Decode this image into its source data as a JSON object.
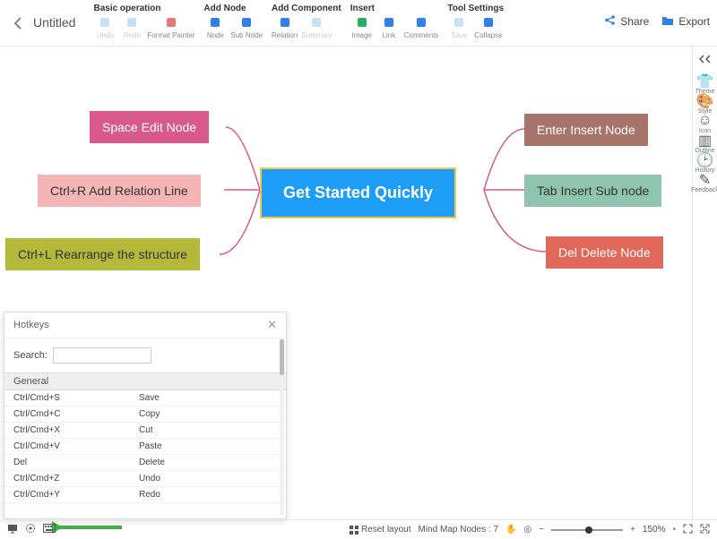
{
  "title": "Untitled",
  "toolbar": {
    "groups": [
      {
        "label": "Basic operation",
        "items": [
          {
            "name": "undo",
            "label": "Undo",
            "disabled": true,
            "color": "#c7e0f4"
          },
          {
            "name": "redo",
            "label": "Redo",
            "disabled": true,
            "color": "#c7e0f4"
          },
          {
            "name": "format-painter",
            "label": "Format Painter",
            "disabled": false,
            "color": "#e07a7a"
          }
        ]
      },
      {
        "label": "Add Node",
        "items": [
          {
            "name": "node",
            "label": "Node",
            "disabled": false,
            "color": "#2f80ed"
          },
          {
            "name": "sub-node",
            "label": "Sub Node",
            "disabled": false,
            "color": "#2f80ed"
          }
        ]
      },
      {
        "label": "Add Component",
        "items": [
          {
            "name": "relation",
            "label": "Relation",
            "disabled": false,
            "color": "#2f80ed"
          },
          {
            "name": "summary",
            "label": "Summary",
            "disabled": true,
            "color": "#c7e0f4"
          }
        ]
      },
      {
        "label": "Insert",
        "items": [
          {
            "name": "image",
            "label": "Image",
            "disabled": false,
            "color": "#27ae60"
          },
          {
            "name": "link",
            "label": "Link",
            "disabled": false,
            "color": "#2f80ed"
          },
          {
            "name": "comments",
            "label": "Comments",
            "disabled": false,
            "color": "#2f80ed"
          }
        ]
      },
      {
        "label": "Tool Settings",
        "items": [
          {
            "name": "save",
            "label": "Save",
            "disabled": true,
            "color": "#c7e0f4"
          },
          {
            "name": "collapse",
            "label": "Collapse",
            "disabled": false,
            "color": "#2f80ed"
          }
        ]
      }
    ],
    "share": "Share",
    "export": "Export"
  },
  "nodes": {
    "central": "Get Started Quickly",
    "left1": "Space Edit Node",
    "left2": "Ctrl+R Add Relation Line",
    "left3": "Ctrl+L Rearrange the structure",
    "right1": "Enter Insert Node",
    "right2": "Tab Insert Sub node",
    "right3": "Del Delete Node"
  },
  "sidepanel": [
    {
      "name": "theme",
      "label": "Theme",
      "icon": "👕"
    },
    {
      "name": "style",
      "label": "Style",
      "icon": "🎨"
    },
    {
      "name": "icon",
      "label": "Icon",
      "icon": "☺"
    },
    {
      "name": "outline",
      "label": "Outline",
      "icon": "▥"
    },
    {
      "name": "history",
      "label": "History",
      "icon": "🕑"
    },
    {
      "name": "feedback",
      "label": "Feedback",
      "icon": "✎"
    }
  ],
  "popup": {
    "title": "Hotkeys",
    "search_label": "Search:",
    "section": "General",
    "rows": [
      {
        "key": "Ctrl/Cmd+S",
        "action": "Save"
      },
      {
        "key": "Ctrl/Cmd+C",
        "action": "Copy"
      },
      {
        "key": "Ctrl/Cmd+X",
        "action": "Cut"
      },
      {
        "key": "Ctrl/Cmd+V",
        "action": "Paste"
      },
      {
        "key": "Del",
        "action": "Delete"
      },
      {
        "key": "Ctrl/Cmd+Z",
        "action": "Undo"
      },
      {
        "key": "Ctrl/Cmd+Y",
        "action": "Redo"
      }
    ]
  },
  "status": {
    "reset": "Reset layout",
    "nodes_label": "Mind Map Nodes :",
    "nodes_count": "7",
    "zoom": "150%"
  }
}
